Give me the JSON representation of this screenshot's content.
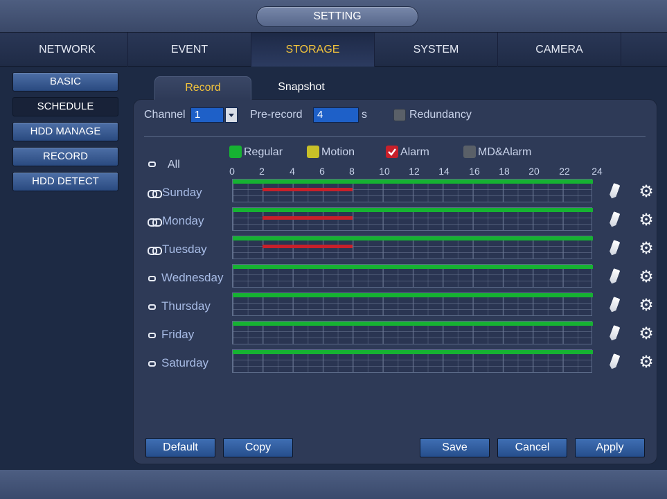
{
  "window": {
    "title": "SETTING"
  },
  "tabs": [
    "NETWORK",
    "EVENT",
    "STORAGE",
    "SYSTEM",
    "CAMERA"
  ],
  "active_tab": "STORAGE",
  "sidebar": {
    "items": [
      {
        "label": "BASIC",
        "active": false
      },
      {
        "label": "SCHEDULE",
        "active": true
      },
      {
        "label": "HDD MANAGE",
        "active": false
      },
      {
        "label": "RECORD",
        "active": false
      },
      {
        "label": "HDD DETECT",
        "active": false
      }
    ]
  },
  "subtabs": {
    "record": "Record",
    "snapshot": "Snapshot",
    "active": "Record"
  },
  "controls": {
    "channel_label": "Channel",
    "channel_value": "1",
    "prerecord_label": "Pre-record",
    "prerecord_value": "4",
    "prerecord_unit": "s",
    "redundancy_label": "Redundancy",
    "redundancy_checked": false
  },
  "legend": {
    "all_label": "All",
    "items": [
      {
        "label": "Regular",
        "color": "#16b232",
        "checked": false
      },
      {
        "label": "Motion",
        "color": "#c8c028",
        "checked": false
      },
      {
        "label": "Alarm",
        "color": "#c8202a",
        "checked": true
      },
      {
        "label": "MD&Alarm",
        "color": "#5a6068",
        "checked": false
      }
    ]
  },
  "hours": [
    "0",
    "2",
    "4",
    "6",
    "8",
    "10",
    "12",
    "14",
    "16",
    "18",
    "20",
    "22",
    "24"
  ],
  "schedule": [
    {
      "day": "Sunday",
      "linked": true,
      "regular": [
        0,
        24
      ],
      "alarm": [
        2,
        8
      ]
    },
    {
      "day": "Monday",
      "linked": true,
      "regular": [
        0,
        24
      ],
      "alarm": [
        2,
        8
      ]
    },
    {
      "day": "Tuesday",
      "linked": true,
      "regular": [
        0,
        24
      ],
      "alarm": [
        2,
        8
      ]
    },
    {
      "day": "Wednesday",
      "linked": false,
      "regular": [
        0,
        24
      ],
      "alarm": null
    },
    {
      "day": "Thursday",
      "linked": false,
      "regular": [
        0,
        24
      ],
      "alarm": null
    },
    {
      "day": "Friday",
      "linked": false,
      "regular": [
        0,
        24
      ],
      "alarm": null
    },
    {
      "day": "Saturday",
      "linked": false,
      "regular": [
        0,
        24
      ],
      "alarm": null
    }
  ],
  "buttons": {
    "default": "Default",
    "copy": "Copy",
    "save": "Save",
    "cancel": "Cancel",
    "apply": "Apply"
  },
  "icons": {
    "row_edit": "pencil-icon",
    "row_settings": "gear-icon",
    "linked": "link-icon",
    "unlinked": "toggle-icon"
  }
}
